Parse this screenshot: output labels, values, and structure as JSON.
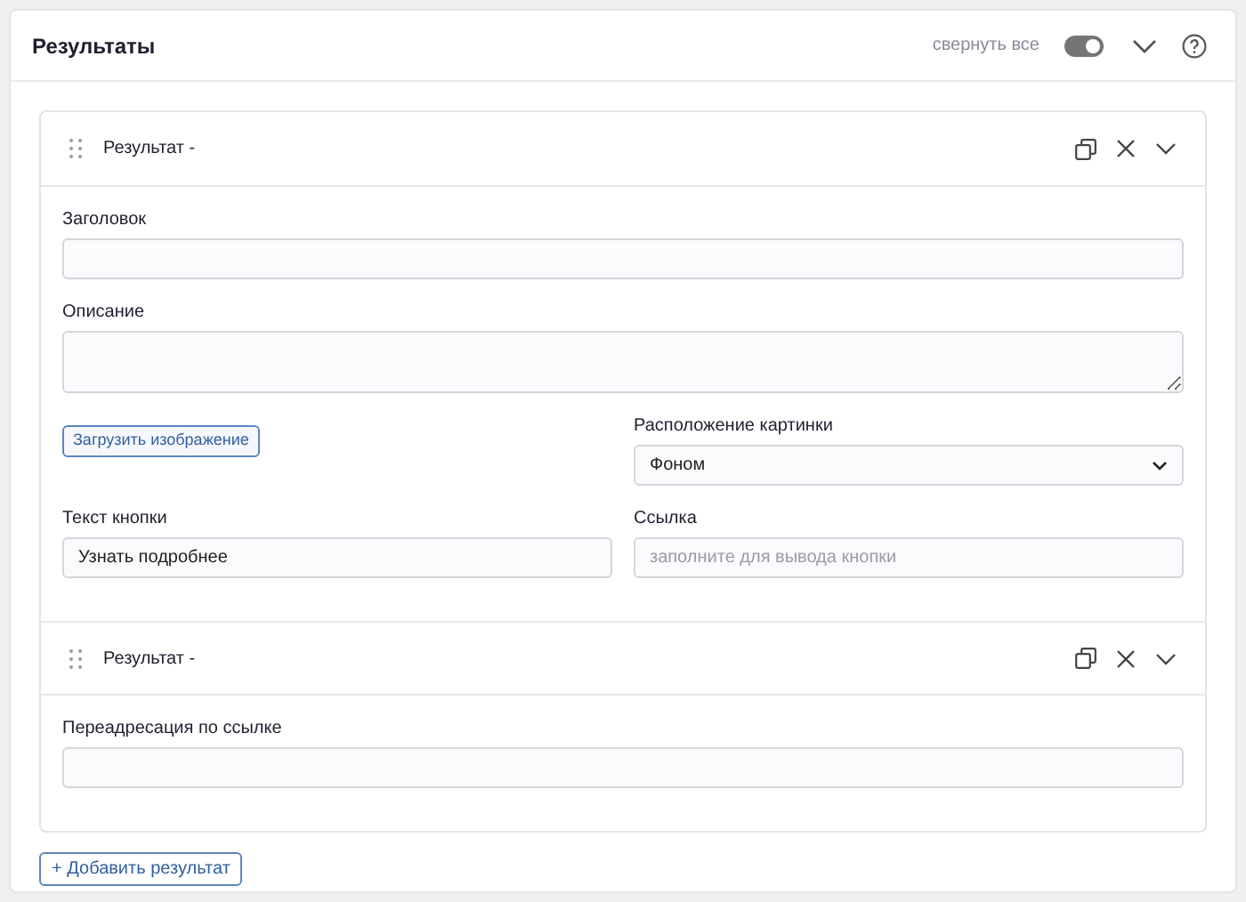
{
  "panel": {
    "title": "Результаты",
    "collapse_all_label": "свернуть все",
    "collapse_all_on": true
  },
  "items": [
    {
      "title": "Результат -",
      "rows": [
        [
          {
            "kind": "text",
            "label": "Заголовок"
          }
        ],
        [
          {
            "kind": "textarea",
            "label": "Описание"
          }
        ],
        [
          {
            "kind": "upload",
            "label": "Загрузить изображение"
          },
          {
            "kind": "select",
            "label": "Расположение картинки",
            "value": "Фоном"
          }
        ],
        [
          {
            "kind": "text",
            "label": "Текст кнопки",
            "value": "Узнать подробнее"
          },
          {
            "kind": "text",
            "label": "Ссылка",
            "placeholder": "заполните для вывода кнопки"
          }
        ]
      ]
    },
    {
      "title": "Результат -",
      "rows": [
        [
          {
            "kind": "text",
            "label": "Переадресация по ссылке"
          }
        ]
      ]
    }
  ],
  "add_button": "+ Добавить результат"
}
